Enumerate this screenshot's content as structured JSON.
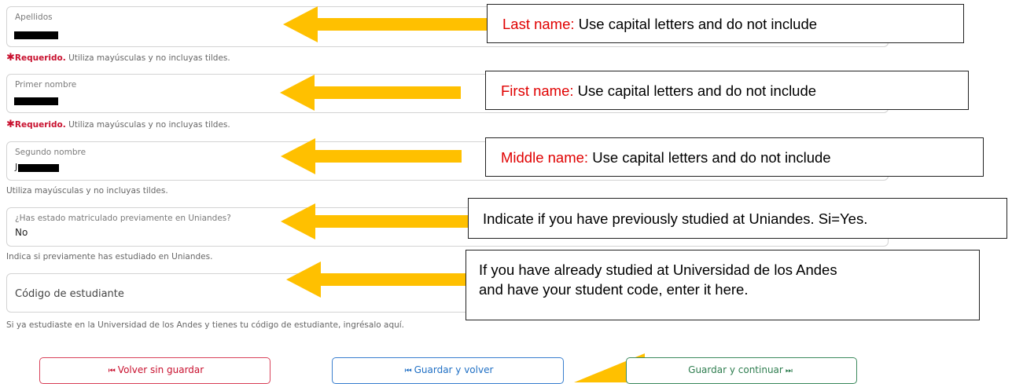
{
  "fields": [
    {
      "label": "Apellidos",
      "value": ""
    },
    {
      "label": "Primer nombre",
      "value": ""
    },
    {
      "label": "Segundo nombre",
      "value": "J"
    },
    {
      "label": "¿Has estado matriculado previamente en Uniandes?",
      "value": "No"
    },
    {
      "placeholder": "Código de estudiante"
    }
  ],
  "help": {
    "required": "Requerido.",
    "required_mark": "✱",
    "caps_hint": " Utiliza mayúsculas y no incluyas tildes.",
    "caps_hint_plain": "Utiliza mayúsculas y no incluyas tildes.",
    "prior_hint": "Indica si previamente has estudiado en Uniandes.",
    "code_hint": "Si ya estudiaste en la Universidad de los Andes y tienes tu código de estudiante, ingrésalo aquí."
  },
  "callouts": [
    {
      "key": "Last name:",
      "text": " Use capital letters and do not include"
    },
    {
      "key": "First name:",
      "text": " Use capital letters and do not include"
    },
    {
      "key": "Middle name:",
      "text": " Use capital letters and do not include"
    },
    {
      "text": "Indicate if you have previously studied at Uniandes. Si=Yes."
    },
    {
      "line1": "If you have already studied at Universidad de los Andes",
      "line2": "and have your student code, enter it here."
    }
  ],
  "buttons": {
    "back_no_save": "Volver sin guardar",
    "save_back": "Guardar y volver",
    "save_continue": "Guardar y continuar",
    "back_glyph": "⏮",
    "forward_glyph": "⏭"
  },
  "colors": {
    "arrow": "#FFC000",
    "danger": "#c8102e",
    "primary": "#1f6fc4",
    "success": "#2e7d4f",
    "callout_key": "#e00000"
  }
}
